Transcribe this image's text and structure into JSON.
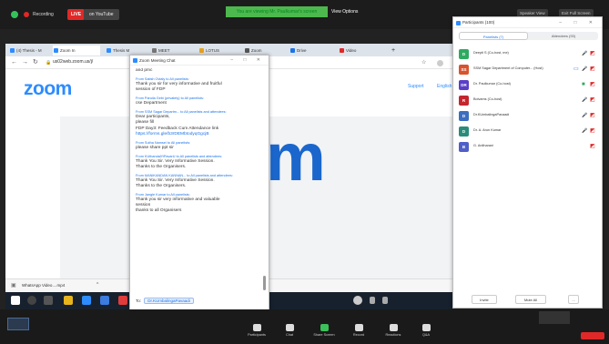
{
  "topbar": {
    "recording": "Recording",
    "live": "LIVE",
    "youtube": "on YouTube",
    "sharing": "You are viewing Mr. Paulkumar's screen",
    "view_options": "View Options",
    "right_btn_1": "Speaker View",
    "right_btn_2": "Exit Full Screen"
  },
  "browser": {
    "tabs": [
      "(4) Thesis - M",
      "Zoom In",
      "Thesis M",
      "MEET",
      "LOTUS",
      "Zoom",
      "Drive",
      "Video"
    ],
    "url": "us02web.zoom.us/j/",
    "logo": "zoom",
    "links": [
      "Support",
      "English"
    ],
    "big_letter": "m",
    "download": "WhatsApp Video....mp4"
  },
  "chat": {
    "title": "Zoom Meeting Chat",
    "messages": [
      {
        "from": "",
        "lines": [
          "and pmc"
        ]
      },
      {
        "from": "From Satish Ovtaly to All panelists:",
        "lines": [
          "Thank you sir for very informative and fruitful",
          "session of FDP"
        ]
      },
      {
        "from": "From Paruila Gebi (privately) to All panelists:",
        "lines": [
          "cse Department"
        ]
      },
      {
        "from": "From SSM Sagar Departm... to All panelists and attendees:",
        "lines": [
          "Dear participants,",
          "please fill",
          "FDP Day3: Feedback Cum Attendance link"
        ],
        "link": "https://forms.gle/b3rDEMbtodyqGgcjB"
      },
      {
        "from": "From Sutha Namsel to All panelists:",
        "lines": [
          "please share ppt sir"
        ]
      },
      {
        "from": "From KUthandalYiPavarU to All panelists and attendees:",
        "lines": [
          "Thank You Sir. Very Informative Session.",
          "Thanks to the Organisers."
        ]
      },
      {
        "from": "From MANIKANDAN KANNAN... to All panelists and attendees:",
        "lines": [
          "Thank You Sir. Very Informative Session.",
          "Thanks to the Organisers."
        ]
      },
      {
        "from": "From Jangle Kumar to All panelists:",
        "lines": [
          "Thank you sir very informative and valuable",
          "session",
          "thanks to all Organisers"
        ]
      }
    ],
    "to_label": "To:",
    "to_value": "Dr.KUmbalingaPavaadi",
    "placeholder": "Type message here..."
  },
  "participants": {
    "title": "Participants (100)",
    "tab_panelists": "Panelists (7)",
    "tab_attendees": "Attendees (93)",
    "rows": [
      {
        "initial": "D",
        "name": "Deepti S (Co-host, me)",
        "color": "#2eaa60",
        "icons": "mic-video"
      },
      {
        "initial": "SS",
        "name": "SSM Sagar Department of Computer... (Host)",
        "color": "#d9532e",
        "icons": "share-mic-video"
      },
      {
        "initial": "DR",
        "name": "Dr. Paulkumar (Co-host)",
        "color": "#5a3ec8",
        "icons": "talk-video"
      },
      {
        "initial": "R",
        "name": "Bolvams (Co-host)",
        "color": "#c4262e",
        "icons": "mic-video"
      },
      {
        "initial": "D",
        "name": "Dr.KUmbalingaPavaadi",
        "color": "#3c6ebf",
        "icons": "mic-video"
      },
      {
        "initial": "D",
        "name": "Dr. A. Arun Kumar",
        "color": "#2a8c7a",
        "icons": "mic-video"
      },
      {
        "initial": "B",
        "name": "G. Anitharani",
        "color": "#4f5fc8",
        "icons": "video"
      }
    ],
    "footer": [
      "Invite",
      "Mute All",
      "..."
    ]
  },
  "toolbar": {
    "buttons": [
      "Participants",
      "Chat",
      "Share Screen",
      "Record",
      "Reactions",
      "Q&A"
    ],
    "end": "End"
  }
}
